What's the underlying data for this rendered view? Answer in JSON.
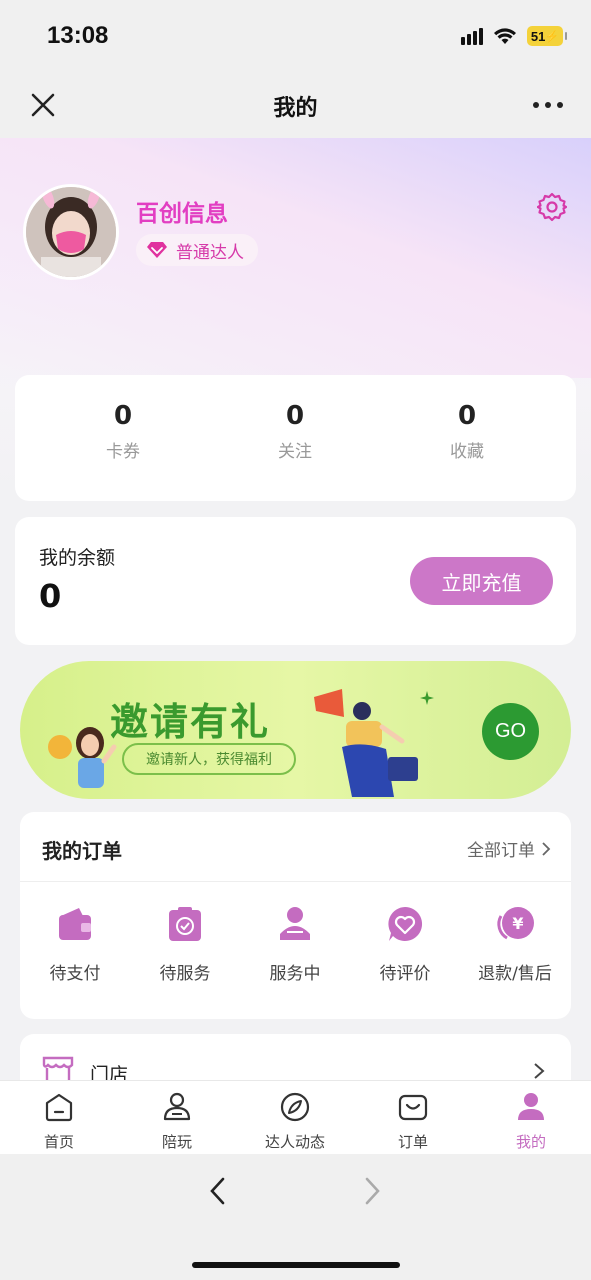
{
  "status_bar": {
    "time": "13:08",
    "battery": "51"
  },
  "nav": {
    "title": "我的"
  },
  "profile": {
    "name": "百创信息",
    "level": "普通达人"
  },
  "stats": [
    {
      "value": "0",
      "label": "卡券"
    },
    {
      "value": "0",
      "label": "关注"
    },
    {
      "value": "0",
      "label": "收藏"
    }
  ],
  "balance": {
    "label": "我的余额",
    "value": "0",
    "button": "立即充值"
  },
  "invite": {
    "title": "邀请有礼",
    "subtitle": "邀请新人，获得福利",
    "go": "GO"
  },
  "orders": {
    "title": "我的订单",
    "view_all": "全部订单",
    "items": [
      {
        "label": "待支付",
        "icon": "wallet-icon"
      },
      {
        "label": "待服务",
        "icon": "clipboard-check-icon"
      },
      {
        "label": "服务中",
        "icon": "user-service-icon"
      },
      {
        "label": "待评价",
        "icon": "heart-chat-icon"
      },
      {
        "label": "退款/售后",
        "icon": "refund-icon"
      }
    ]
  },
  "store": {
    "label": "门店"
  },
  "tabbar": [
    {
      "label": "首页",
      "icon": "home-icon"
    },
    {
      "label": "陪玩",
      "icon": "companion-icon"
    },
    {
      "label": "达人动态",
      "icon": "compass-icon"
    },
    {
      "label": "订单",
      "icon": "bag-icon"
    },
    {
      "label": "我的",
      "icon": "person-icon",
      "active": true
    }
  ],
  "colors": {
    "accent": "#c46cc0",
    "name": "#e23ec2",
    "button": "#cc77c8",
    "banner_green": "#2c9a32"
  }
}
